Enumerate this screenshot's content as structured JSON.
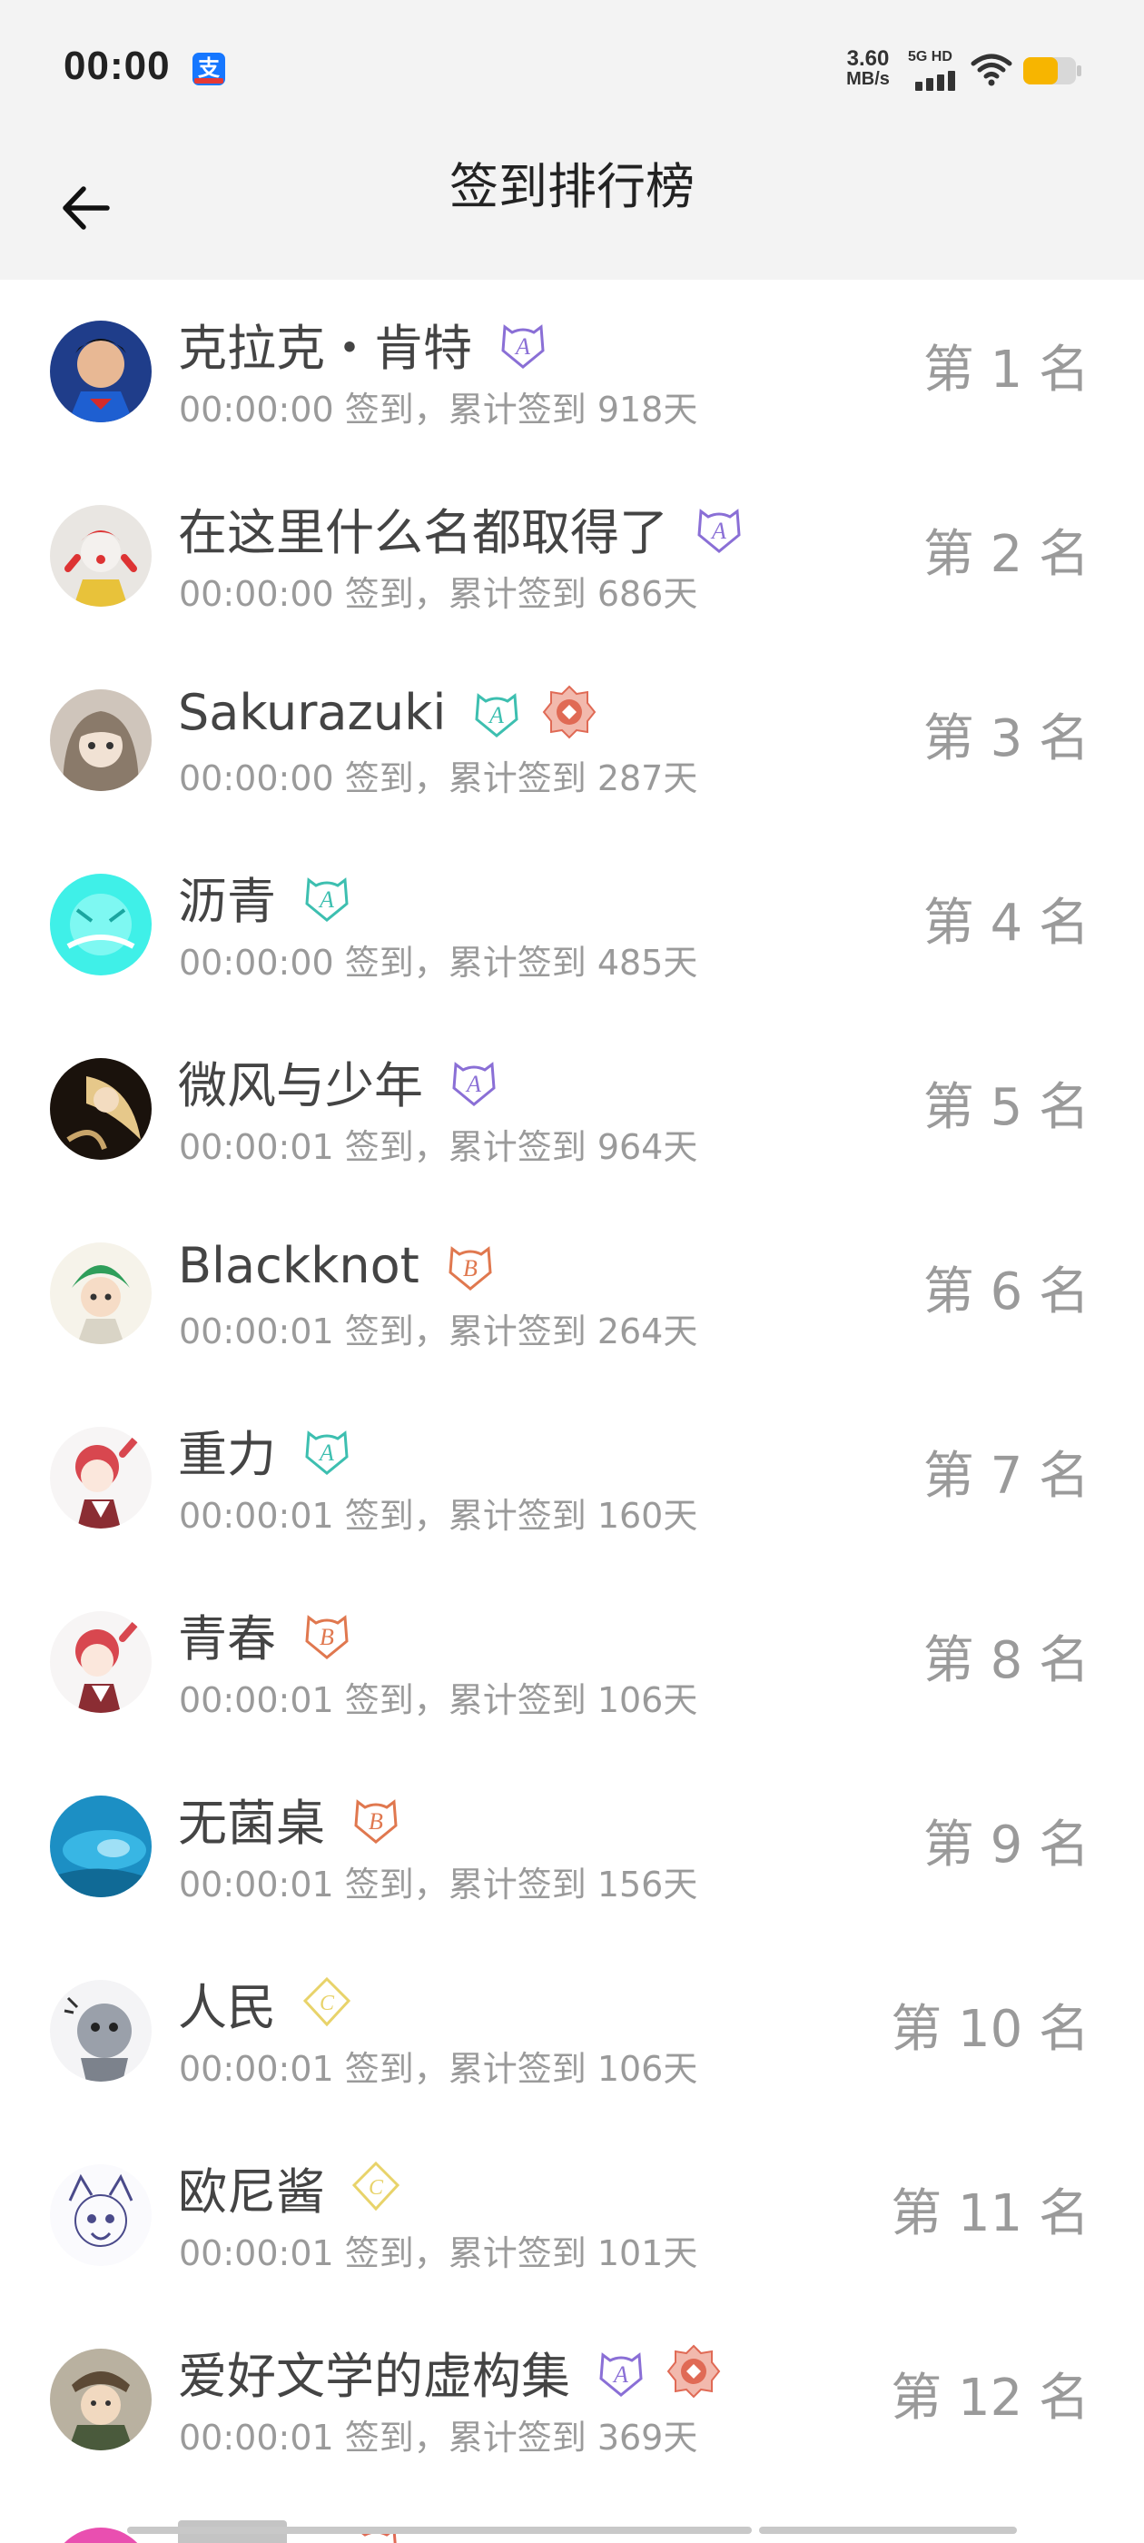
{
  "status_bar": {
    "time": "00:00",
    "app_icon": "alipay-icon",
    "alipay_glyph": "支",
    "net_speed_value": "3.60",
    "net_speed_unit": "MB/s",
    "signal_label": "5G HD",
    "battery_color": "#f7b500"
  },
  "header": {
    "title": "签到排行榜",
    "back_icon": "arrow-left-icon"
  },
  "ranking": [
    {
      "name": "克拉克・肯特",
      "subtitle": "00:00:00 签到，累计签到 918天",
      "rank": "第 1 名",
      "badges": [
        "A"
      ]
    },
    {
      "name": "在这里什么名都取得了",
      "subtitle": "00:00:00 签到，累计签到 686天",
      "rank": "第 2 名",
      "badges": [
        "A"
      ]
    },
    {
      "name": "Sakurazuki",
      "subtitle": "00:00:00 签到，累计签到 287天",
      "rank": "第 3 名",
      "badges": [
        "A-teal",
        "medal"
      ]
    },
    {
      "name": "沥青",
      "subtitle": "00:00:00 签到，累计签到 485天",
      "rank": "第 4 名",
      "badges": [
        "A-teal"
      ]
    },
    {
      "name": "微风与少年",
      "subtitle": "00:00:01 签到，累计签到 964天",
      "rank": "第 5 名",
      "badges": [
        "A"
      ]
    },
    {
      "name": "Blackknot",
      "subtitle": "00:00:01 签到，累计签到 264天",
      "rank": "第 6 名",
      "badges": [
        "B"
      ]
    },
    {
      "name": "重力",
      "subtitle": "00:00:01 签到，累计签到 160天",
      "rank": "第 7 名",
      "badges": [
        "A-teal"
      ]
    },
    {
      "name": "青春",
      "subtitle": "00:00:01 签到，累计签到 106天",
      "rank": "第 8 名",
      "badges": [
        "B"
      ]
    },
    {
      "name": "无菌桌",
      "subtitle": "00:00:01 签到，累计签到 156天",
      "rank": "第 9 名",
      "badges": [
        "B"
      ]
    },
    {
      "name": "人民",
      "subtitle": "00:00:01 签到，累计签到 106天",
      "rank": "第 10 名",
      "badges": [
        "C"
      ]
    },
    {
      "name": "欧尼酱",
      "subtitle": "00:00:01 签到，累计签到 101天",
      "rank": "第 11 名",
      "badges": [
        "C"
      ]
    },
    {
      "name": "爱好文学的虚构集",
      "subtitle": "00:00:01 签到，累计签到 369天",
      "rank": "第 12 名",
      "badges": [
        "A",
        "medal"
      ]
    }
  ],
  "colors": {
    "badge_A": "#8a6fd6",
    "badge_A_teal": "#3dbfb0",
    "badge_B": "#e0784f",
    "badge_C": "#e8d36a",
    "medal": "#e06a55",
    "rank_text": "#9a9a9a"
  }
}
